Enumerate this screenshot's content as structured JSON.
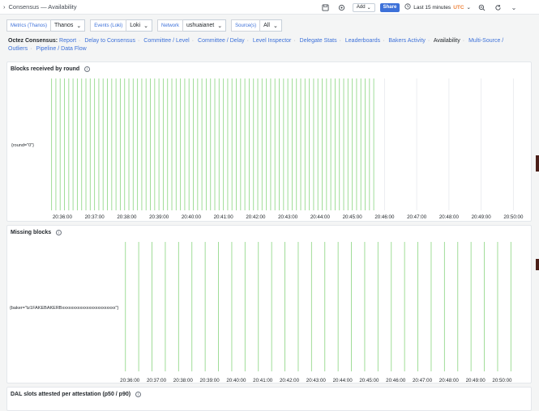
{
  "header": {
    "breadcrumb": "Consensus — Availability",
    "add_label": "Add",
    "share_label": "Share",
    "time_range": "Last 15 minutes",
    "timezone": "UTC"
  },
  "variables": [
    {
      "label": "Metrics (Thanos)",
      "value": "Thanos"
    },
    {
      "label": "Events (Loki)",
      "value": "Loki"
    },
    {
      "label": "Network",
      "value": "ushuaianet"
    },
    {
      "label": "Source(s)",
      "value": "All"
    }
  ],
  "nav": {
    "lead": "Octez Consensus:",
    "links": [
      "Report",
      "Delay to Consensus",
      "Committee / Level",
      "Committee / Delay",
      "Level Inspector",
      "Delegate Stats",
      "Leaderboards",
      "Bakers Activity",
      "Availability",
      "Multi-Source / Outliers",
      "Pipeline / Data Flow"
    ],
    "current": "Availability"
  },
  "colors": {
    "accent": "#3d71d9",
    "bar_line": "#96d98d",
    "utc": "#ef843c"
  },
  "panels": [
    {
      "title": "Blocks received by round",
      "series_label": "{round=\"0\"}",
      "x_ticks": [
        "20:36:00",
        "20:37:00",
        "20:38:00",
        "20:39:00",
        "20:40:00",
        "20:41:00",
        "20:42:00",
        "20:43:00",
        "20:44:00",
        "20:45:00",
        "20:46:00",
        "20:47:00",
        "20:48:00",
        "20:49:00",
        "20:50:00"
      ]
    },
    {
      "title": "Missing blocks",
      "series_label": "{baker=\"tz1FAKEBAKERBxxxxxxxxxxxxxxxxxxxxxxxx\"}",
      "x_ticks": [
        "20:36:00",
        "20:37:00",
        "20:38:00",
        "20:39:00",
        "20:40:00",
        "20:41:00",
        "20:42:00",
        "20:43:00",
        "20:44:00",
        "20:45:00",
        "20:46:00",
        "20:47:00",
        "20:48:00",
        "20:49:00",
        "20:50:00"
      ]
    },
    {
      "title": "DAL slots attested per attestation (p50 / p90)"
    }
  ],
  "chart_data": [
    {
      "type": "bar",
      "title": "Blocks received by round",
      "series": [
        {
          "name": "{round=\"0\"}"
        }
      ],
      "x_start": "20:35:30",
      "x_ticks": [
        "20:36:00",
        "20:37:00",
        "20:38:00",
        "20:39:00",
        "20:40:00",
        "20:41:00",
        "20:42:00",
        "20:43:00",
        "20:44:00",
        "20:45:00",
        "20:46:00",
        "20:47:00",
        "20:48:00",
        "20:49:00",
        "20:50:00"
      ],
      "event_times": [
        "20:35:40",
        "20:35:48",
        "20:35:56",
        "20:36:04",
        "20:36:12",
        "20:36:20",
        "20:36:28",
        "20:36:36",
        "20:36:44",
        "20:36:52",
        "20:37:00",
        "20:37:08",
        "20:37:16",
        "20:37:24",
        "20:37:32",
        "20:37:40",
        "20:37:48",
        "20:37:56",
        "20:38:04",
        "20:38:12",
        "20:38:20",
        "20:38:28",
        "20:38:36",
        "20:38:44",
        "20:38:52",
        "20:39:00",
        "20:39:08",
        "20:39:16",
        "20:39:24",
        "20:39:32",
        "20:39:40",
        "20:39:48",
        "20:39:56",
        "20:40:04",
        "20:40:12",
        "20:40:20",
        "20:40:28",
        "20:40:36",
        "20:40:44",
        "20:40:52",
        "20:41:00",
        "20:41:08",
        "20:41:16",
        "20:41:24",
        "20:41:32",
        "20:41:40",
        "20:41:48",
        "20:41:56",
        "20:42:04",
        "20:42:12",
        "20:42:20",
        "20:42:28",
        "20:42:36",
        "20:42:44",
        "20:42:52",
        "20:43:00",
        "20:43:08",
        "20:43:16",
        "20:43:24",
        "20:43:32",
        "20:43:40",
        "20:43:48",
        "20:43:56",
        "20:44:04",
        "20:44:12",
        "20:44:20",
        "20:44:28",
        "20:44:36",
        "20:44:44",
        "20:44:52",
        "20:45:00",
        "20:45:08",
        "20:45:16",
        "20:45:24",
        "20:45:32",
        "20:45:40"
      ],
      "faint_times": [
        "20:46:00",
        "20:47:00",
        "20:48:00",
        "20:49:00",
        "20:50:00"
      ]
    },
    {
      "type": "bar",
      "title": "Missing blocks",
      "series": [
        {
          "name": "{baker=\"tz1FAKEBAKERBxxxxxxxxxxxxxxxxxxxxxxxx\"}"
        }
      ],
      "x_start": "20:35:45",
      "x_ticks": [
        "20:36:00",
        "20:37:00",
        "20:38:00",
        "20:39:00",
        "20:40:00",
        "20:41:00",
        "20:42:00",
        "20:43:00",
        "20:44:00",
        "20:45:00",
        "20:46:00",
        "20:47:00",
        "20:48:00",
        "20:49:00",
        "20:50:00"
      ],
      "event_times": [
        "20:35:50",
        "20:36:20",
        "20:36:50",
        "20:37:20",
        "20:37:50",
        "20:38:20",
        "20:38:50",
        "20:39:20",
        "20:39:50",
        "20:40:20",
        "20:40:50",
        "20:41:20",
        "20:41:50",
        "20:42:20",
        "20:42:50",
        "20:43:20",
        "20:43:50",
        "20:44:20",
        "20:44:50",
        "20:45:20",
        "20:45:50",
        "20:46:20",
        "20:46:50",
        "20:47:20",
        "20:47:50",
        "20:48:20",
        "20:48:50",
        "20:49:20",
        "20:49:50",
        "20:50:20"
      ]
    }
  ]
}
